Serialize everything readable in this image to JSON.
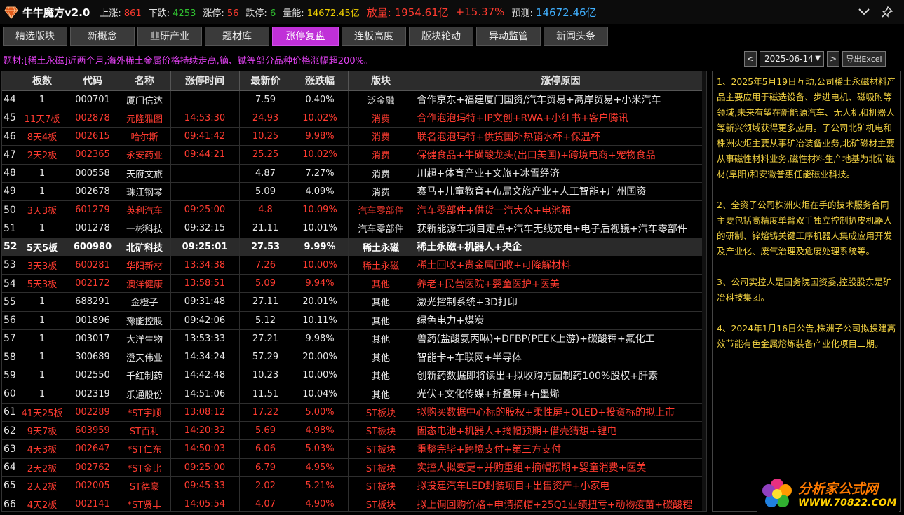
{
  "app": {
    "title": "牛牛魔方v2.0"
  },
  "stats": [
    {
      "label": "上涨:",
      "value": "861",
      "color": "red"
    },
    {
      "label": "下跌:",
      "value": "4253",
      "color": "green"
    },
    {
      "label": "涨停:",
      "value": "56",
      "color": "red"
    },
    {
      "label": "跌停:",
      "value": "6",
      "color": "green"
    },
    {
      "label": "量能:",
      "value": "14672.45亿",
      "color": "yellow"
    }
  ],
  "volume": {
    "label": "放量:",
    "value": "1954.61亿",
    "pct": "+15.37%"
  },
  "forecast": {
    "label": "预测:",
    "value": "14672.46亿"
  },
  "nav": [
    "精选版块",
    "新概念",
    "韭研产业",
    "题材库",
    "涨停复盘",
    "连板高度",
    "版块轮动",
    "异动监管",
    "新闻头条"
  ],
  "nav_active": 4,
  "topic": "题材:[稀土永磁]近两个月,海外稀土金属价格持续走高,镝、铽等部分品种价格涨幅超200%。",
  "date": {
    "prev": "<",
    "value": "2025-06-14",
    "next": ">",
    "export": "导出Excel"
  },
  "table": {
    "headers": [
      "",
      "板数",
      "代码",
      "名称",
      "涨停时间",
      "最新价",
      "涨跌幅",
      "版块",
      "涨停原因"
    ],
    "rows": [
      {
        "idx": "44",
        "boards": "1",
        "code": "000701",
        "name": "厦门信达",
        "time": "",
        "price": "7.59",
        "pct": "0.40%",
        "sector": "泛金融",
        "reason": "合作京东+福建厦门国资/汽车贸易+离岸贸易+小米汽车",
        "red": false
      },
      {
        "idx": "45",
        "boards": "11天7板",
        "code": "002878",
        "name": "元隆雅图",
        "time": "14:53:30",
        "price": "24.93",
        "pct": "10.02%",
        "sector": "消费",
        "reason": "合作泡泡玛特+IP文创+RWA+小红书+客户腾讯",
        "red": true
      },
      {
        "idx": "46",
        "boards": "8天4板",
        "code": "002615",
        "name": "哈尔斯",
        "time": "09:41:42",
        "price": "10.25",
        "pct": "9.98%",
        "sector": "消费",
        "reason": "联名泡泡玛特+供货国外热销水杯+保温杯",
        "red": true
      },
      {
        "idx": "47",
        "boards": "2天2板",
        "code": "002365",
        "name": "永安药业",
        "time": "09:44:21",
        "price": "25.25",
        "pct": "10.02%",
        "sector": "消费",
        "reason": "保健食品+牛磺酸龙头(出口美国)+跨境电商+宠物食品",
        "red": true
      },
      {
        "idx": "48",
        "boards": "1",
        "code": "000558",
        "name": "天府文旅",
        "time": "",
        "price": "4.87",
        "pct": "7.27%",
        "sector": "消费",
        "reason": "川超+体育产业+文旅+冰雪经济",
        "red": false
      },
      {
        "idx": "49",
        "boards": "1",
        "code": "002678",
        "name": "珠江钢琴",
        "time": "",
        "price": "5.09",
        "pct": "4.09%",
        "sector": "消费",
        "reason": "赛马+儿童教育+布局文旅产业+人工智能+广州国资",
        "red": false
      },
      {
        "idx": "50",
        "boards": "3天3板",
        "code": "601279",
        "name": "英利汽车",
        "time": "09:25:00",
        "price": "4.8",
        "pct": "10.09%",
        "sector": "汽车零部件",
        "reason": "汽车零部件+供货一汽大众+电池箱",
        "red": true
      },
      {
        "idx": "51",
        "boards": "1",
        "code": "001278",
        "name": "一彬科技",
        "time": "09:32:15",
        "price": "21.11",
        "pct": "10.01%",
        "sector": "汽车零部件",
        "reason": "获新能源车项目定点+汽车无线充电+电子后视镜+汽车零部件",
        "red": false
      },
      {
        "idx": "52",
        "boards": "5天5板",
        "code": "600980",
        "name": "北矿科技",
        "time": "09:25:01",
        "price": "27.53",
        "pct": "9.99%",
        "sector": "稀土永磁",
        "reason": "稀土永磁+机器人+央企",
        "red": false,
        "selected": true
      },
      {
        "idx": "53",
        "boards": "3天3板",
        "code": "600281",
        "name": "华阳新材",
        "time": "13:34:38",
        "price": "7.26",
        "pct": "10.00%",
        "sector": "稀土永磁",
        "reason": "稀土回收+贵金属回收+可降解材料",
        "red": true
      },
      {
        "idx": "54",
        "boards": "5天3板",
        "code": "002172",
        "name": "澳洋健康",
        "time": "13:58:51",
        "price": "5.09",
        "pct": "9.94%",
        "sector": "其他",
        "reason": "养老+民营医院+婴童医护+医美",
        "red": true
      },
      {
        "idx": "55",
        "boards": "1",
        "code": "688291",
        "name": "金橙子",
        "time": "09:31:48",
        "price": "27.11",
        "pct": "20.01%",
        "sector": "其他",
        "reason": "激光控制系统+3D打印",
        "red": false
      },
      {
        "idx": "56",
        "boards": "1",
        "code": "001896",
        "name": "豫能控股",
        "time": "09:42:06",
        "price": "5.12",
        "pct": "10.11%",
        "sector": "其他",
        "reason": "绿色电力+煤炭",
        "red": false
      },
      {
        "idx": "57",
        "boards": "1",
        "code": "003017",
        "name": "大洋生物",
        "time": "13:53:33",
        "price": "27.21",
        "pct": "9.98%",
        "sector": "其他",
        "reason": "兽药(盐酸氨丙啉)+DFBP(PEEK上游)+碳酸钾+氟化工",
        "red": false
      },
      {
        "idx": "58",
        "boards": "1",
        "code": "300689",
        "name": "澄天伟业",
        "time": "14:34:24",
        "price": "57.29",
        "pct": "20.00%",
        "sector": "其他",
        "reason": "智能卡+车联网+半导体",
        "red": false
      },
      {
        "idx": "59",
        "boards": "1",
        "code": "002550",
        "name": "千红制药",
        "time": "14:42:48",
        "price": "10.23",
        "pct": "10.00%",
        "sector": "其他",
        "reason": "创新药数据即将读出+拟收购方园制药100%股权+肝素",
        "red": false
      },
      {
        "idx": "60",
        "boards": "1",
        "code": "002319",
        "name": "乐通股份",
        "time": "14:51:06",
        "price": "11.51",
        "pct": "10.04%",
        "sector": "其他",
        "reason": "光伏+文化传媒+折叠屏+石墨烯",
        "red": false
      },
      {
        "idx": "61",
        "boards": "41天25板",
        "code": "002289",
        "name": "*ST宇顺",
        "time": "13:08:12",
        "price": "17.22",
        "pct": "5.00%",
        "sector": "ST板块",
        "reason": "拟购买数据中心标的股权+柔性屏+OLED+投资标的拟上市",
        "red": true
      },
      {
        "idx": "62",
        "boards": "9天7板",
        "code": "603959",
        "name": "ST百利",
        "time": "14:20:32",
        "price": "5.69",
        "pct": "4.98%",
        "sector": "ST板块",
        "reason": "固态电池+机器人+摘帽预期+借壳猜想+锂电",
        "red": true
      },
      {
        "idx": "63",
        "boards": "4天3板",
        "code": "002647",
        "name": "*ST仁东",
        "time": "14:50:03",
        "price": "6.06",
        "pct": "5.03%",
        "sector": "ST板块",
        "reason": "重整完毕+跨境支付+第三方支付",
        "red": true
      },
      {
        "idx": "64",
        "boards": "2天2板",
        "code": "002762",
        "name": "*ST金比",
        "time": "09:25:00",
        "price": "6.79",
        "pct": "4.95%",
        "sector": "ST板块",
        "reason": "实控人拟变更+并购重组+摘帽预期+婴童消费+医美",
        "red": true
      },
      {
        "idx": "65",
        "boards": "2天2板",
        "code": "002005",
        "name": "ST德豪",
        "time": "09:45:33",
        "price": "2.02",
        "pct": "5.21%",
        "sector": "ST板块",
        "reason": "拟投建汽车LED封装项目+出售资产+小家电",
        "red": true
      },
      {
        "idx": "66",
        "boards": "4天2板",
        "code": "002141",
        "name": "*ST贤丰",
        "time": "14:05:54",
        "price": "4.07",
        "pct": "4.90%",
        "sector": "ST板块",
        "reason": "拟上调回购价格+申请摘帽+25Q1业绩扭亏+动物疫苗+碳酸锂",
        "red": true
      }
    ]
  },
  "side_notes": [
    "1、2025年5月19日互动,公司稀土永磁材料产品主要应用于磁选设备、步进电机、磁吸附等领域,未来有望在新能源汽车、无人机和机器人等新兴领域获得更多应用。子公司北矿机电和株洲火炬主要从事矿冶装备业务,北矿磁材主要从事磁性材料业务,磁性材料生产地基为北矿磁材(阜阳)和安徽普惠任能磁业科技。",
    "2、全资子公司株洲火炬在手的技术服务合同主要包括高精度单臂双手独立控制扒皮机器人的研制、锌熔铸关键工序机器人集成应用开发及产业化、废气治理及危废处理系统等。",
    "3、公司实控人是国务院国资委,控股股东是矿冶科技集团。",
    "4、2024年1月16日公告,株洲子公司拟投建高效节能有色金属熔炼装备产业化项目二期。"
  ],
  "watermark": {
    "line1": "分析家公式网",
    "line2": "WWW.70822.COM"
  },
  "icons": {
    "logo": "diamond-logo-icon",
    "collapse": "chevron-down-icon",
    "pin": "pin-icon"
  }
}
